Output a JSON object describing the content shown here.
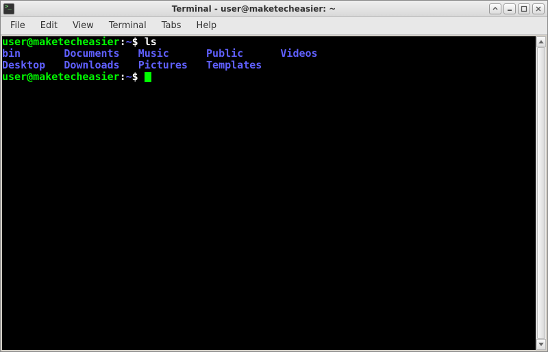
{
  "titlebar": {
    "title": "Terminal - user@maketecheasier: ~"
  },
  "menubar": {
    "items": [
      "File",
      "Edit",
      "View",
      "Terminal",
      "Tabs",
      "Help"
    ]
  },
  "terminal": {
    "prompt_user": "user@maketecheasier",
    "prompt_sep1": ":",
    "prompt_path": "~",
    "prompt_sep2": "$ ",
    "lines": [
      {
        "type": "prompt",
        "command": "ls"
      },
      {
        "type": "dirlist",
        "cols": [
          "bin     ",
          "Documents ",
          "Music    ",
          "Public    ",
          "Videos"
        ]
      },
      {
        "type": "dirlist",
        "cols": [
          "Desktop ",
          "Downloads ",
          "Pictures ",
          "Templates"
        ]
      },
      {
        "type": "prompt",
        "command": "",
        "cursor": true
      }
    ]
  }
}
